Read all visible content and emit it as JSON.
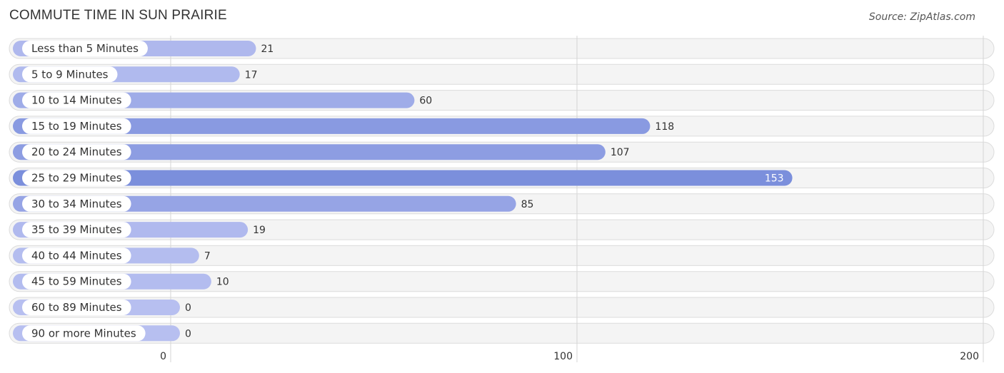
{
  "chart_data": {
    "type": "bar",
    "orientation": "horizontal",
    "title": "COMMUTE TIME IN SUN PRAIRIE",
    "source": "Source: ZipAtlas.com",
    "xlabel": "",
    "ylabel": "",
    "categories": [
      "Less than 5 Minutes",
      "5 to 9 Minutes",
      "10 to 14 Minutes",
      "15 to 19 Minutes",
      "20 to 24 Minutes",
      "25 to 29 Minutes",
      "30 to 34 Minutes",
      "35 to 39 Minutes",
      "40 to 44 Minutes",
      "45 to 59 Minutes",
      "60 to 89 Minutes",
      "90 or more Minutes"
    ],
    "values": [
      21,
      17,
      60,
      118,
      107,
      153,
      85,
      19,
      7,
      10,
      0,
      0
    ],
    "xlim": [
      0,
      200
    ],
    "xticks": [
      0,
      100,
      200
    ],
    "grid": true,
    "legend": "none",
    "colors": {
      "bar_low": "#b7bff0",
      "bar_high": "#7b8fdc",
      "row_background": "#f4f4f4"
    }
  }
}
